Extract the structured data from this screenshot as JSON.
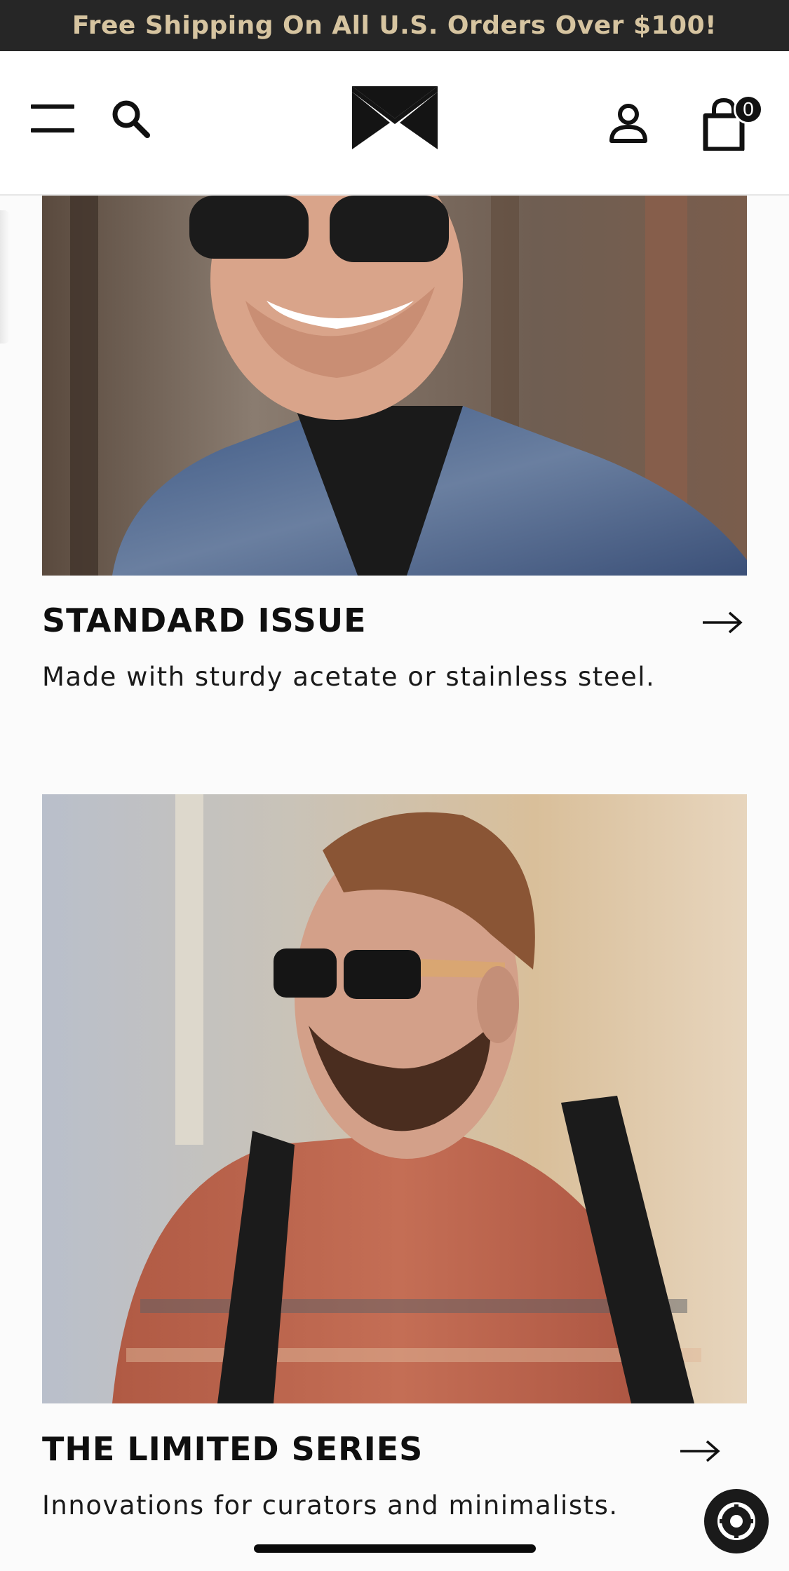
{
  "promo": {
    "text": "Free Shipping On All U.S. Orders Over $100!"
  },
  "header": {
    "menu_icon": "hamburger-menu-icon",
    "search_icon": "search-icon",
    "logo_icon": "brand-logo",
    "account_icon": "account-icon",
    "cart_icon": "shopping-bag-icon",
    "cart_count": "0"
  },
  "collections": [
    {
      "title": "STANDARD ISSUE",
      "description": "Made with sturdy acetate or stainless steel.",
      "arrow_icon": "arrow-right-icon"
    },
    {
      "title": "THE LIMITED SERIES",
      "description": "Innovations for curators and minimalists.",
      "arrow_icon": "arrow-right-icon"
    }
  ],
  "chat": {
    "icon": "chat-support-icon"
  },
  "colors": {
    "promo_bg": "#262626",
    "promo_text": "#d6c4a0",
    "page_bg": "#fbfbfb"
  }
}
